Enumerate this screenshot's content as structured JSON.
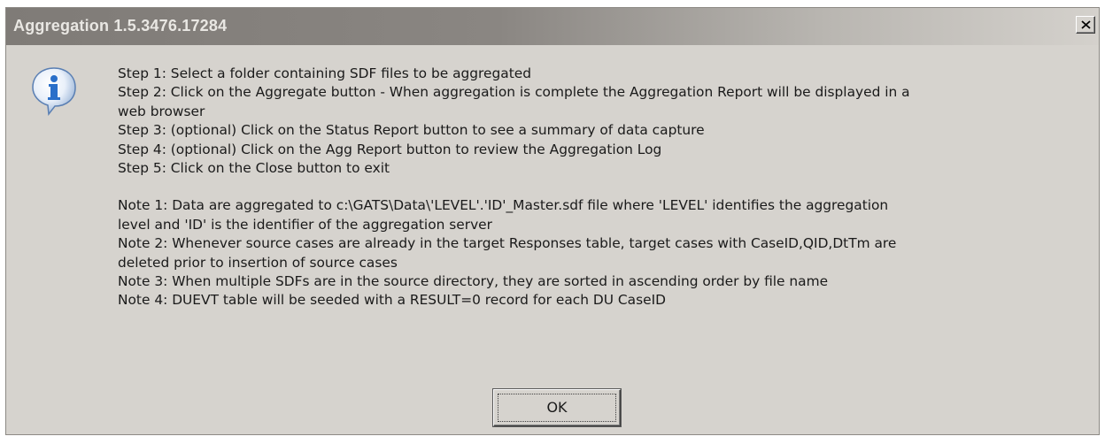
{
  "window": {
    "title": "Aggregation 1.5.3476.17284"
  },
  "icons": {
    "dialog_icon": "info-icon",
    "close": "close-icon"
  },
  "message": {
    "steps": [
      "Step 1: Select a folder containing SDF files to be aggregated",
      "Step 2: Click on the Aggregate button - When aggregation is complete the Aggregation Report will be displayed in a",
      "web browser",
      "Step 3: (optional) Click on the Status Report button to see a summary of data capture",
      "Step 4: (optional) Click on the Agg Report button to review the Aggregation Log",
      "Step 5: Click on the Close button to exit"
    ],
    "notes": [
      "Note 1: Data are aggregated to c:\\GATS\\Data\\'LEVEL'.'ID'_Master.sdf file where 'LEVEL' identifies the aggregation",
      "level and 'ID' is the identifier of the aggregation server",
      "Note 2: Whenever source cases are already in the target Responses table, target cases with CaseID,QID,DtTm are",
      "deleted prior to insertion of source cases",
      "Note 3: When multiple SDFs are in the source directory, they are sorted in ascending order by file name",
      "Note 4: DUEVT table will be seeded with a RESULT=0 record for each DU CaseID"
    ]
  },
  "buttons": {
    "ok_label": "OK"
  },
  "colors": {
    "dialog_bg": "#d6d3ce",
    "icon_blue": "#2a6fc9"
  }
}
